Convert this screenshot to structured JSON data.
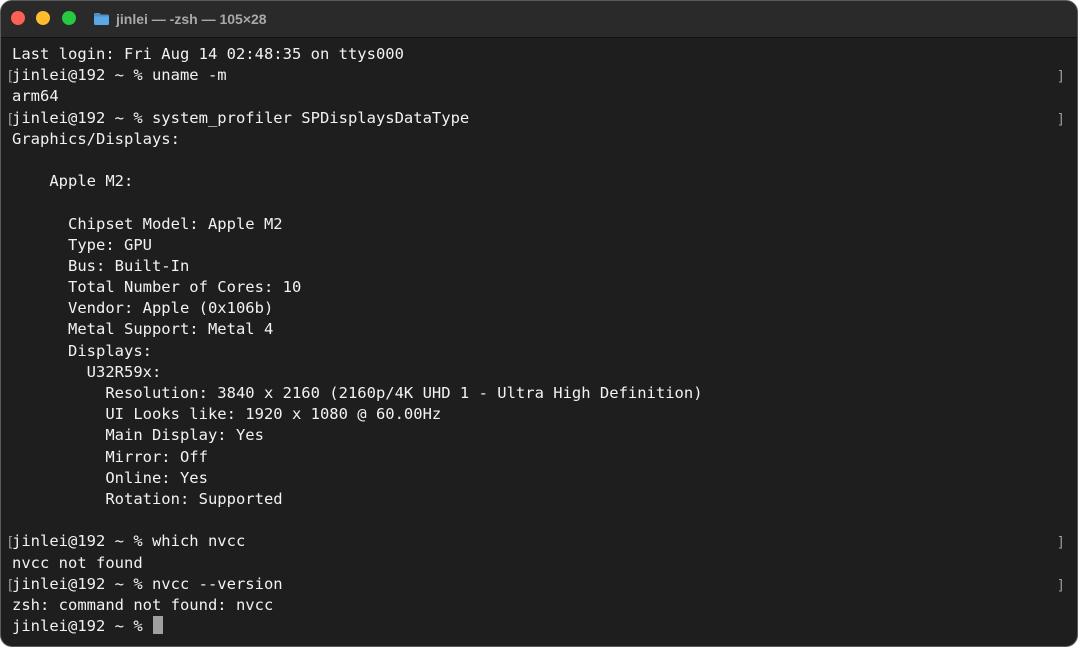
{
  "window": {
    "title": "jinlei — -zsh — 105×28",
    "colors": {
      "close": "#fe5f57",
      "minimize": "#febc2e",
      "zoom": "#28c840",
      "folder": "#5aa9e6",
      "background": "#1e1e1e",
      "text": "#f2f2f2"
    }
  },
  "terminal": {
    "lines": [
      {
        "text": "Last login: Fri Aug 14 02:48:35 on ttys000",
        "prompt": false
      },
      {
        "text": "jinlei@192 ~ % uname -m",
        "prompt": true
      },
      {
        "text": "arm64",
        "prompt": false
      },
      {
        "text": "jinlei@192 ~ % system_profiler SPDisplaysDataType",
        "prompt": true
      },
      {
        "text": "Graphics/Displays:",
        "prompt": false
      },
      {
        "text": "",
        "prompt": false
      },
      {
        "text": "    Apple M2:",
        "prompt": false
      },
      {
        "text": "",
        "prompt": false
      },
      {
        "text": "      Chipset Model: Apple M2",
        "prompt": false
      },
      {
        "text": "      Type: GPU",
        "prompt": false
      },
      {
        "text": "      Bus: Built-In",
        "prompt": false
      },
      {
        "text": "      Total Number of Cores: 10",
        "prompt": false
      },
      {
        "text": "      Vendor: Apple (0x106b)",
        "prompt": false
      },
      {
        "text": "      Metal Support: Metal 4",
        "prompt": false
      },
      {
        "text": "      Displays:",
        "prompt": false
      },
      {
        "text": "        U32R59x:",
        "prompt": false
      },
      {
        "text": "          Resolution: 3840 x 2160 (2160p/4K UHD 1 - Ultra High Definition)",
        "prompt": false
      },
      {
        "text": "          UI Looks like: 1920 x 1080 @ 60.00Hz",
        "prompt": false
      },
      {
        "text": "          Main Display: Yes",
        "prompt": false
      },
      {
        "text": "          Mirror: Off",
        "prompt": false
      },
      {
        "text": "          Online: Yes",
        "prompt": false
      },
      {
        "text": "          Rotation: Supported",
        "prompt": false
      },
      {
        "text": "",
        "prompt": false
      },
      {
        "text": "jinlei@192 ~ % which nvcc",
        "prompt": true
      },
      {
        "text": "nvcc not found",
        "prompt": false
      },
      {
        "text": "jinlei@192 ~ % nvcc --version",
        "prompt": true
      },
      {
        "text": "zsh: command not found: nvcc",
        "prompt": false
      }
    ],
    "current_prompt": "jinlei@192 ~ % "
  }
}
